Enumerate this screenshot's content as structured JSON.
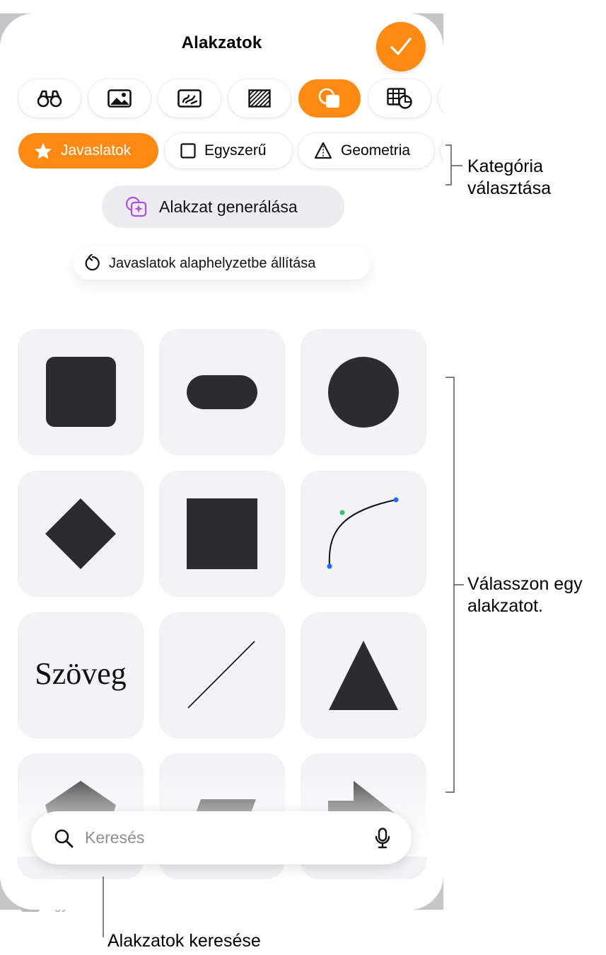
{
  "sheet": {
    "title": "Alakzatok",
    "done_icon": "checkmark-icon",
    "accent_color": "#fd8a14"
  },
  "media_tabs": [
    {
      "icon": "binoculars-icon",
      "active": false
    },
    {
      "icon": "photo-icon",
      "active": false
    },
    {
      "icon": "drawing-icon",
      "active": false
    },
    {
      "icon": "pattern-icon",
      "active": false
    },
    {
      "icon": "shapes-icon",
      "active": true
    },
    {
      "icon": "table-chart-icon",
      "active": false
    }
  ],
  "categories": [
    {
      "label": "Javaslatok",
      "icon": "star-icon",
      "active": true
    },
    {
      "label": "Egyszerű",
      "icon": "square-outline-icon",
      "active": false
    },
    {
      "label": "Geometria",
      "icon": "pyramid-icon",
      "active": false
    }
  ],
  "generate_button": {
    "label": "Alakzat generálása",
    "icon": "sparkle-shapes-icon"
  },
  "reset_button": {
    "label": "Javaslatok alaphelyzetbe állítása",
    "icon": "reset-arrow-icon"
  },
  "shapes": [
    {
      "name": "rounded-square"
    },
    {
      "name": "pill"
    },
    {
      "name": "circle"
    },
    {
      "name": "diamond"
    },
    {
      "name": "square"
    },
    {
      "name": "curve"
    },
    {
      "name": "text",
      "label": "Szöveg"
    },
    {
      "name": "line"
    },
    {
      "name": "triangle"
    },
    {
      "name": "pentagon"
    },
    {
      "name": "parallelogram"
    },
    {
      "name": "arrow"
    }
  ],
  "search": {
    "placeholder": "Keresés",
    "icon": "search-icon",
    "mic_icon": "microphone-icon"
  },
  "background_peek": {
    "label": "Egyszerű"
  },
  "callouts": {
    "category": {
      "line1": "Kategória",
      "line2": "választása"
    },
    "shape": {
      "line1": "Válasszon egy",
      "line2": "alakzatot."
    },
    "search": {
      "text": "Alakzatok keresése"
    }
  }
}
